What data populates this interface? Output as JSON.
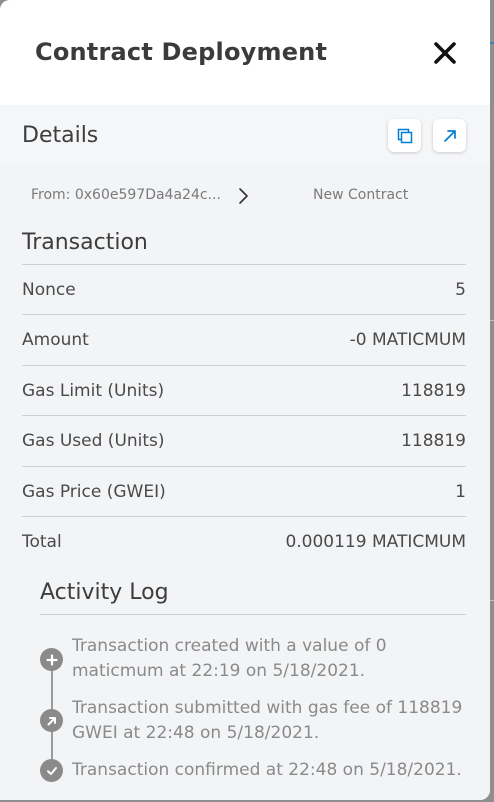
{
  "header": {
    "title": "Contract Deployment"
  },
  "details": {
    "label": "Details"
  },
  "route": {
    "from": "From: 0x60e597Da4a24c...",
    "to": "New Contract"
  },
  "transaction": {
    "title": "Transaction",
    "rows": [
      {
        "label": "Nonce",
        "value": "5"
      },
      {
        "label": "Amount",
        "value": "-0 MATICMUM"
      },
      {
        "label": "Gas Limit (Units)",
        "value": "118819"
      },
      {
        "label": "Gas Used (Units)",
        "value": "118819"
      },
      {
        "label": "Gas Price (GWEI)",
        "value": "1"
      },
      {
        "label": "Total",
        "value": "0.000119 MATICMUM"
      }
    ]
  },
  "activity": {
    "title": "Activity Log",
    "entries": [
      {
        "icon": "plus-icon",
        "text": "Transaction created with a value of 0 maticmum at 22:19 on 5/18/2021."
      },
      {
        "icon": "arrow-up-right-icon",
        "text": "Transaction submitted with gas fee of 118819 GWEI at 22:48 on 5/18/2021."
      },
      {
        "icon": "check-icon",
        "text": "Transaction confirmed at 22:48 on 5/18/2021."
      }
    ]
  },
  "colors": {
    "accent": "#037dd6",
    "text": "#3d3d3d",
    "muted": "#8a8a8a"
  }
}
